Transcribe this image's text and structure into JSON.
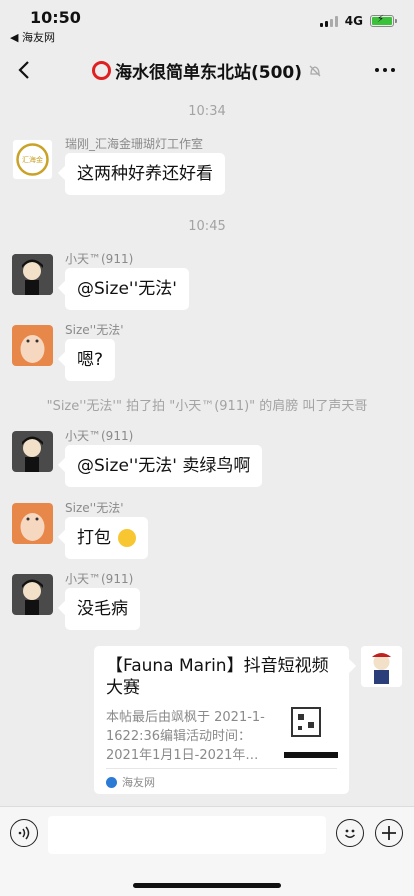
{
  "status_bar": {
    "time": "10:50",
    "back_app": "◀ 海友网",
    "network": "4G"
  },
  "nav": {
    "title": "海水很简单东北站(500)"
  },
  "chat": {
    "timestamps": [
      "10:34",
      "10:45"
    ],
    "messages": [
      {
        "sender": "瑞刚_汇海金珊瑚灯工作室",
        "text": "这两种好养还好看",
        "avatar_text": "汇海金"
      },
      {
        "sender": "小天™(911)",
        "text": "@Size''无法'"
      },
      {
        "sender": "Size''无法'",
        "text": "嗯?"
      },
      {
        "sender": "小天™(911)",
        "text": "@Size''无法' 卖绿鸟啊"
      },
      {
        "sender": "Size''无法'",
        "text": "打包"
      },
      {
        "sender": "小天™(911)",
        "text": "没毛病"
      }
    ],
    "system_notice": "\"Size''无法'\" 拍了拍 \"小天™(911)\" 的肩膀 叫了声天哥",
    "link_card": {
      "title": "【Fauna Marin】抖音短视频大赛",
      "description": "本帖最后由飒枫于 2021-1-1622:36编辑活动时间：2021年1月1日-2021年…",
      "source": "海友网"
    }
  },
  "colors": {
    "accent_red": "#e02020",
    "battery_green": "#3cc13b",
    "background": "#ededed"
  }
}
